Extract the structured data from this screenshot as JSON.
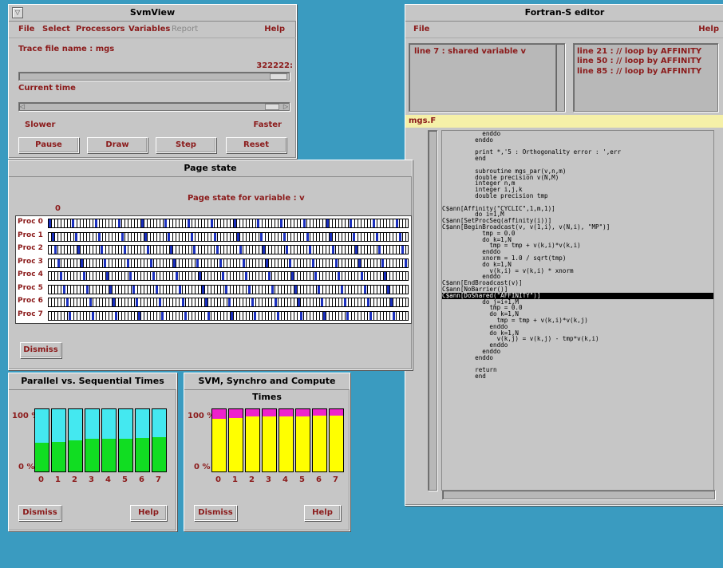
{
  "svmview": {
    "title": "SvmView",
    "menu": [
      "File",
      "Select",
      "Processors",
      "Variables",
      "Report",
      "Help"
    ],
    "trace_label": "Trace file name : mgs",
    "time_value": "322222:",
    "current_time_label": "Current time",
    "slower": "Slower",
    "faster": "Faster",
    "buttons": [
      "Pause",
      "Draw",
      "Step",
      "Reset"
    ]
  },
  "page_state": {
    "title": "Page state",
    "subtitle": "Page state for variable : v",
    "zero_label": "0",
    "procs": [
      "Proc  0",
      "Proc  1",
      "Proc  2",
      "Proc  3",
      "Proc  4",
      "Proc  5",
      "Proc  6",
      "Proc  7"
    ],
    "dismiss": "Dismiss"
  },
  "parallel": {
    "title": "Parallel vs. Sequential Times",
    "y_top": "100 %",
    "y_bottom": "0 %",
    "x_labels": [
      "0",
      "1",
      "2",
      "3",
      "4",
      "5",
      "6",
      "7"
    ],
    "green_percent": [
      46,
      48,
      50,
      52,
      53,
      53,
      54,
      55
    ],
    "colors": {
      "top": "#44e8f0",
      "bottom": "#11dd22"
    },
    "dismiss": "Dismiss",
    "help": "Help"
  },
  "svm": {
    "title": "SVM, Synchro and Compute Times",
    "y_top": "100 %",
    "y_bottom": "0 %",
    "x_labels": [
      "0",
      "1",
      "2",
      "3",
      "4",
      "5",
      "6",
      "7"
    ],
    "yellow_percent": [
      84,
      86,
      88,
      88,
      88,
      88,
      90,
      90
    ],
    "colors": {
      "top": "#ee22cc",
      "bottom": "#ffff00"
    },
    "dismiss": "Dismiss",
    "help": "Help"
  },
  "fortran": {
    "title": "Fortran-S editor",
    "menu_file": "File",
    "menu_help": "Help",
    "left_list": [
      "line   7 : shared variable v"
    ],
    "right_list": [
      "line  21 : // loop by AFFINITY",
      "line  50 : // loop by AFFINITY",
      "line  85 : // loop by AFFINITY"
    ],
    "filename": "mgs.F",
    "code": [
      "           enddo",
      "         enddo",
      "",
      "         print *,'5 : Orthogonality error : ',err",
      "         end",
      "",
      "         subroutine mgs_par(v,n,m)",
      "         double precision v(N,M)",
      "         integer n,m",
      "         integer i,j,k",
      "         double precision tmp",
      "",
      "C$ann[Affinity(\"CYCLIC\",1,m,1)]",
      "         do i=1,M",
      "C$ann[SetProcSeq(affinity(i))]",
      "C$ann[BeginBroadcast(v, v(1,i), v(N,i), \"MP\")]",
      "           tmp = 0.0",
      "           do k=1,N",
      "             tmp = tmp + v(k,i)*v(k,i)",
      "           enddo",
      "           xnorm = 1.0 / sqrt(tmp)",
      "           do k=1,N",
      "             v(k,i) = v(k,i) * xnorm",
      "           enddo",
      "C$ann[EndBroadcast(v)]",
      "C$ann[NoBarrier()]",
      "C$ann[DoShared(\"AFFINITY\")]",
      "           do j=i+1,M",
      "             tmp = 0.0",
      "             do k=1,N",
      "               tmp = tmp + v(k,i)*v(k,j)",
      "             enddo",
      "             do k=1,N",
      "               v(k,j) = v(k,j) - tmp*v(k,i)",
      "             enddo",
      "           enddo",
      "         enddo",
      "",
      "         return",
      "         end"
    ],
    "highlight_line": 26
  }
}
